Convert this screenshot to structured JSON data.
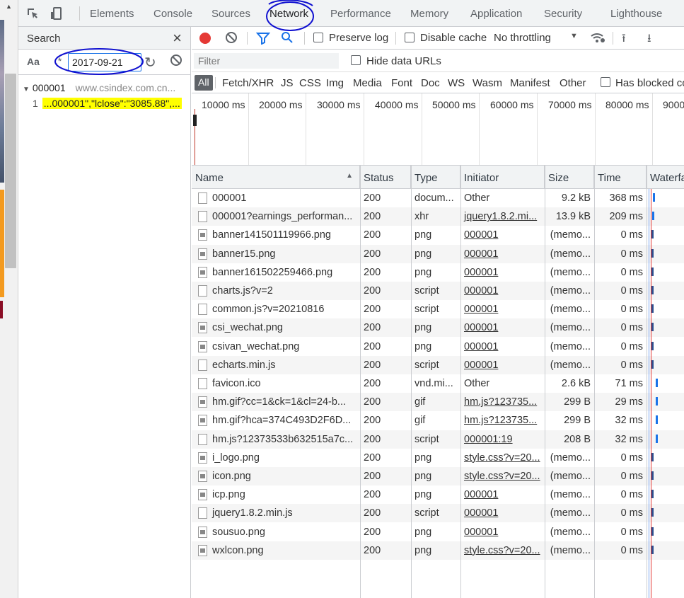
{
  "tabs": [
    "Elements",
    "Console",
    "Sources",
    "Network",
    "Performance",
    "Memory",
    "Application",
    "Security",
    "Lighthouse"
  ],
  "search": {
    "title": "Search",
    "close_label": "×",
    "case_label": "Aa",
    "regex_label": ".*",
    "query": "2017-09-21",
    "result_file": "000001",
    "result_url": "www.csindex.com.cn...",
    "result_line_number": "1",
    "result_text": "...000001\",\"lclose\":\"3085.88\",..."
  },
  "toolbar": {
    "preserve_log": "Preserve log",
    "disable_cache": "Disable cache",
    "throttling": "No throttling"
  },
  "filter": {
    "placeholder": "Filter",
    "hide_data_urls": "Hide data URLs"
  },
  "types": [
    "All",
    "Fetch/XHR",
    "JS",
    "CSS",
    "Img",
    "Media",
    "Font",
    "Doc",
    "WS",
    "Wasm",
    "Manifest",
    "Other"
  ],
  "has_blocked": "Has blocked co",
  "overview_ticks": [
    "10000 ms",
    "20000 ms",
    "30000 ms",
    "40000 ms",
    "50000 ms",
    "60000 ms",
    "70000 ms",
    "80000 ms",
    "9000"
  ],
  "columns": [
    "Name",
    "Status",
    "Type",
    "Initiator",
    "Size",
    "Time",
    "Waterfa"
  ],
  "rows": [
    {
      "name": "000001",
      "status": "200",
      "type": "docum...",
      "initiator": "Other",
      "size": "9.2 kB",
      "time": "368 ms"
    },
    {
      "name": "000001?earnings_performan...",
      "status": "200",
      "type": "xhr",
      "initiator": "jquery1.8.2.mi...",
      "size": "13.9 kB",
      "time": "209 ms"
    },
    {
      "name": "banner141501119966.png",
      "status": "200",
      "type": "png",
      "initiator": "000001",
      "size": "(memo...",
      "time": "0 ms"
    },
    {
      "name": "banner15.png",
      "status": "200",
      "type": "png",
      "initiator": "000001",
      "size": "(memo...",
      "time": "0 ms"
    },
    {
      "name": "banner161502259466.png",
      "status": "200",
      "type": "png",
      "initiator": "000001",
      "size": "(memo...",
      "time": "0 ms"
    },
    {
      "name": "charts.js?v=2",
      "status": "200",
      "type": "script",
      "initiator": "000001",
      "size": "(memo...",
      "time": "0 ms"
    },
    {
      "name": "common.js?v=20210816",
      "status": "200",
      "type": "script",
      "initiator": "000001",
      "size": "(memo...",
      "time": "0 ms"
    },
    {
      "name": "csi_wechat.png",
      "status": "200",
      "type": "png",
      "initiator": "000001",
      "size": "(memo...",
      "time": "0 ms"
    },
    {
      "name": "csivan_wechat.png",
      "status": "200",
      "type": "png",
      "initiator": "000001",
      "size": "(memo...",
      "time": "0 ms"
    },
    {
      "name": "echarts.min.js",
      "status": "200",
      "type": "script",
      "initiator": "000001",
      "size": "(memo...",
      "time": "0 ms"
    },
    {
      "name": "favicon.ico",
      "status": "200",
      "type": "vnd.mi...",
      "initiator": "Other",
      "size": "2.6 kB",
      "time": "71 ms"
    },
    {
      "name": "hm.gif?cc=1&ck=1&cl=24-b...",
      "status": "200",
      "type": "gif",
      "initiator": "hm.js?123735...",
      "size": "299 B",
      "time": "29 ms"
    },
    {
      "name": "hm.gif?hca=374C493D2F6D...",
      "status": "200",
      "type": "gif",
      "initiator": "hm.js?123735...",
      "size": "299 B",
      "time": "32 ms"
    },
    {
      "name": "hm.js?12373533b632515a7c...",
      "status": "200",
      "type": "script",
      "initiator": "000001:19",
      "size": "208 B",
      "time": "32 ms"
    },
    {
      "name": "i_logo.png",
      "status": "200",
      "type": "png",
      "initiator": "style.css?v=20...",
      "size": "(memo...",
      "time": "0 ms"
    },
    {
      "name": "icon.png",
      "status": "200",
      "type": "png",
      "initiator": "style.css?v=20...",
      "size": "(memo...",
      "time": "0 ms"
    },
    {
      "name": "icp.png",
      "status": "200",
      "type": "png",
      "initiator": "000001",
      "size": "(memo...",
      "time": "0 ms"
    },
    {
      "name": "jquery1.8.2.min.js",
      "status": "200",
      "type": "script",
      "initiator": "000001",
      "size": "(memo...",
      "time": "0 ms"
    },
    {
      "name": "sousuo.png",
      "status": "200",
      "type": "png",
      "initiator": "000001",
      "size": "(memo...",
      "time": "0 ms"
    },
    {
      "name": "wxlcon.png",
      "status": "200",
      "type": "png",
      "initiator": "style.css?v=20...",
      "size": "(memo...",
      "time": "0 ms"
    }
  ],
  "colors": {
    "accent": "#1a73e8",
    "record": "#e53935",
    "highlight": "#ffff00",
    "annotation": "#1010d0"
  }
}
